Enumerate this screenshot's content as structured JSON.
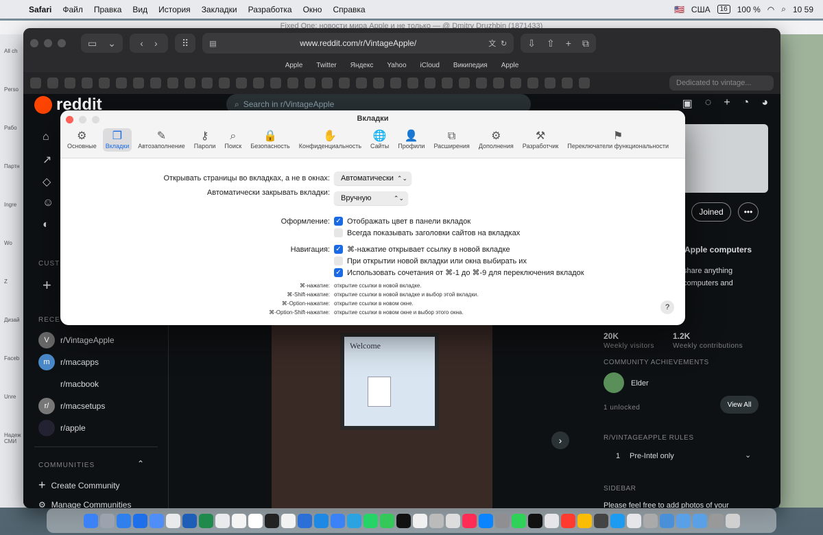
{
  "menubar": {
    "app": "Safari",
    "items": [
      "Файл",
      "Правка",
      "Вид",
      "История",
      "Закладки",
      "Разработка",
      "Окно",
      "Справка"
    ],
    "right": {
      "input": "США",
      "date_box": "16",
      "battery": "100 %",
      "time": "10 59"
    }
  },
  "background_window": {
    "title": "Fixed One: новости мира Apple и не только — @ Dmitry Druzhbin (1871433)",
    "sidebar_labels": [
      "All ch",
      "Perso",
      "Рабо",
      "Партн",
      "Ingre",
      "Wo",
      "Z",
      "Дизай",
      "Faceb",
      "Unre",
      "Надеж СМИ"
    ]
  },
  "safari": {
    "url": "www.reddit.com/r/VintageApple/",
    "favorites": [
      "Apple",
      "Twitter",
      "Яндекс",
      "Yahoo",
      "iCloud",
      "Википедия",
      "Apple"
    ],
    "tab_search": "Dedicated to vintage..."
  },
  "reddit": {
    "logo": "reddit",
    "search_placeholder": "Search in r/VintageApple",
    "custom_section": "CUST",
    "recent_section": "RECE",
    "recent": [
      {
        "name": "r/VintageApple",
        "avatar": "V"
      },
      {
        "name": "r/macapps",
        "avatar": "m"
      },
      {
        "name": "r/macbook",
        "avatar": ""
      },
      {
        "name": "r/macsetups",
        "avatar": "r/"
      },
      {
        "name": "r/apple",
        "avatar": ""
      }
    ],
    "communities_section": "COMMUNITIES",
    "create_community": "Create Community",
    "manage_communities": "Manage Communities",
    "post_photo_welcome": "Welcome",
    "joined_button": "Joined",
    "more_button": "•••",
    "about_title": "Apple computers",
    "about_text_1": "share anything",
    "about_text_2": "computers and",
    "visitors_value": "20K",
    "visitors_label": "Weekly visitors",
    "contrib_value": "1.2K",
    "contrib_label": "Weekly contributions",
    "achievements_heading": "COMMUNITY ACHIEVEMENTS",
    "achievement_name": "Elder",
    "unlocked": "1 unlocked",
    "view_all": "View All",
    "rules_heading": "R/VINTAGEAPPLE RULES",
    "rule_number": "1",
    "rule_text": "Pre-Intel only",
    "sidebar_heading": "SIDEBAR",
    "sidebar_text": "Please feel free to add photos of your"
  },
  "settings": {
    "title": "Вкладки",
    "tabs": [
      {
        "label": "Основные",
        "icon": "⚙"
      },
      {
        "label": "Вкладки",
        "icon": "❐"
      },
      {
        "label": "Автозаполнение",
        "icon": "✎"
      },
      {
        "label": "Пароли",
        "icon": "⚷"
      },
      {
        "label": "Поиск",
        "icon": "⌕"
      },
      {
        "label": "Безопасность",
        "icon": "🔒"
      },
      {
        "label": "Конфиденциальность",
        "icon": "✋"
      },
      {
        "label": "Сайты",
        "icon": "🌐"
      },
      {
        "label": "Профили",
        "icon": "👤"
      },
      {
        "label": "Расширения",
        "icon": "⧉"
      },
      {
        "label": "Дополнения",
        "icon": "⚙"
      },
      {
        "label": "Разработчик",
        "icon": "⚒"
      },
      {
        "label": "Переключатели функциональности",
        "icon": "⚑"
      }
    ],
    "open_pages_label": "Открывать страницы во вкладках, а не в окнах:",
    "open_pages_value": "Автоматически",
    "auto_close_label": "Автоматически закрывать вкладки:",
    "auto_close_value": "Вручную",
    "appearance_label": "Оформление:",
    "appearance_opt1": "Отображать цвет в панели вкладок",
    "appearance_opt2": "Всегда показывать заголовки сайтов на вкладках",
    "navigation_label": "Навигация:",
    "nav_opt1": "⌘-нажатие открывает ссылку в новой вкладке",
    "nav_opt2": "При открытии новой вкладки или окна выбирать их",
    "nav_opt3": "Использовать сочетания от ⌘-1 до ⌘-9 для переключения вкладок",
    "shortcuts": [
      {
        "key": "⌘-нажатие:",
        "desc": "открытие ссылки в новой вкладке."
      },
      {
        "key": "⌘-Shift-нажатие:",
        "desc": "открытие ссылки в новой вкладке и выбор этой вкладки."
      },
      {
        "key": "⌘-Option-нажатие:",
        "desc": "открытие ссылки в новом окне."
      },
      {
        "key": "⌘-Option-Shift-нажатие:",
        "desc": "открытие ссылки в новом окне и выбор этого окна."
      }
    ],
    "help": "?"
  },
  "colors": {
    "accent": "#1a6ae6",
    "reddit_orange": "#ff4500"
  }
}
